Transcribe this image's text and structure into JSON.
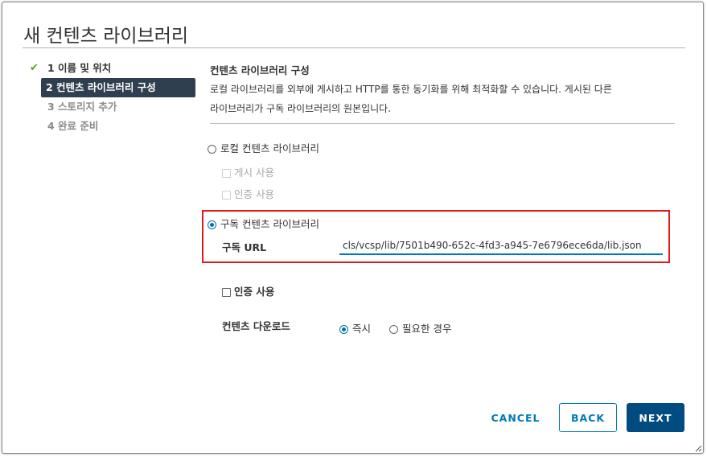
{
  "dialog": {
    "title": "새 컨텐츠 라이브러리"
  },
  "steps": [
    {
      "label": "1 이름 및 위치",
      "state": "done"
    },
    {
      "label": "2 컨텐츠 라이브러리 구성",
      "state": "active"
    },
    {
      "label": "3 스토리지 추가",
      "state": "pending"
    },
    {
      "label": "4 완료 준비",
      "state": "pending"
    }
  ],
  "icons": {
    "step_done": "checkmark-icon",
    "resize": "resize-handle-icon"
  },
  "section": {
    "title": "컨텐츠 라이브러리 구성",
    "desc_line1": "로컬 라이브러리를 외부에 게시하고 HTTP를 통한 동기화를 위해 최적화할 수 있습니다. 게시된 다른",
    "desc_line2": "라이브러리가 구독 라이브러리의 원본입니다."
  },
  "local_library": {
    "label": "로컬 컨텐츠 라이브러리",
    "selected": false,
    "publish_label": "게시 사용",
    "auth_label": "인증 사용"
  },
  "subscribed_library": {
    "label": "구독 컨텐츠 라이브러리",
    "selected": true,
    "url_label": "구독 URL",
    "url_value": "cls/vcsp/lib/7501b490-652c-4fd3-a945-7e6796ece6da/lib.json",
    "auth_label": "인증 사용",
    "download_label": "컨텐츠 다운로드",
    "download_options": [
      {
        "label": "즉시",
        "selected": true
      },
      {
        "label": "필요한 경우",
        "selected": false
      }
    ]
  },
  "footer": {
    "cancel_label": "CANCEL",
    "back_label": "BACK",
    "next_label": "NEXT"
  },
  "colors": {
    "primary": "#0079b8",
    "primary_dark": "#004b80",
    "active_step_bg": "#2f3f4f",
    "check_green": "#5aa220",
    "highlight_red": "#e01b1b"
  }
}
